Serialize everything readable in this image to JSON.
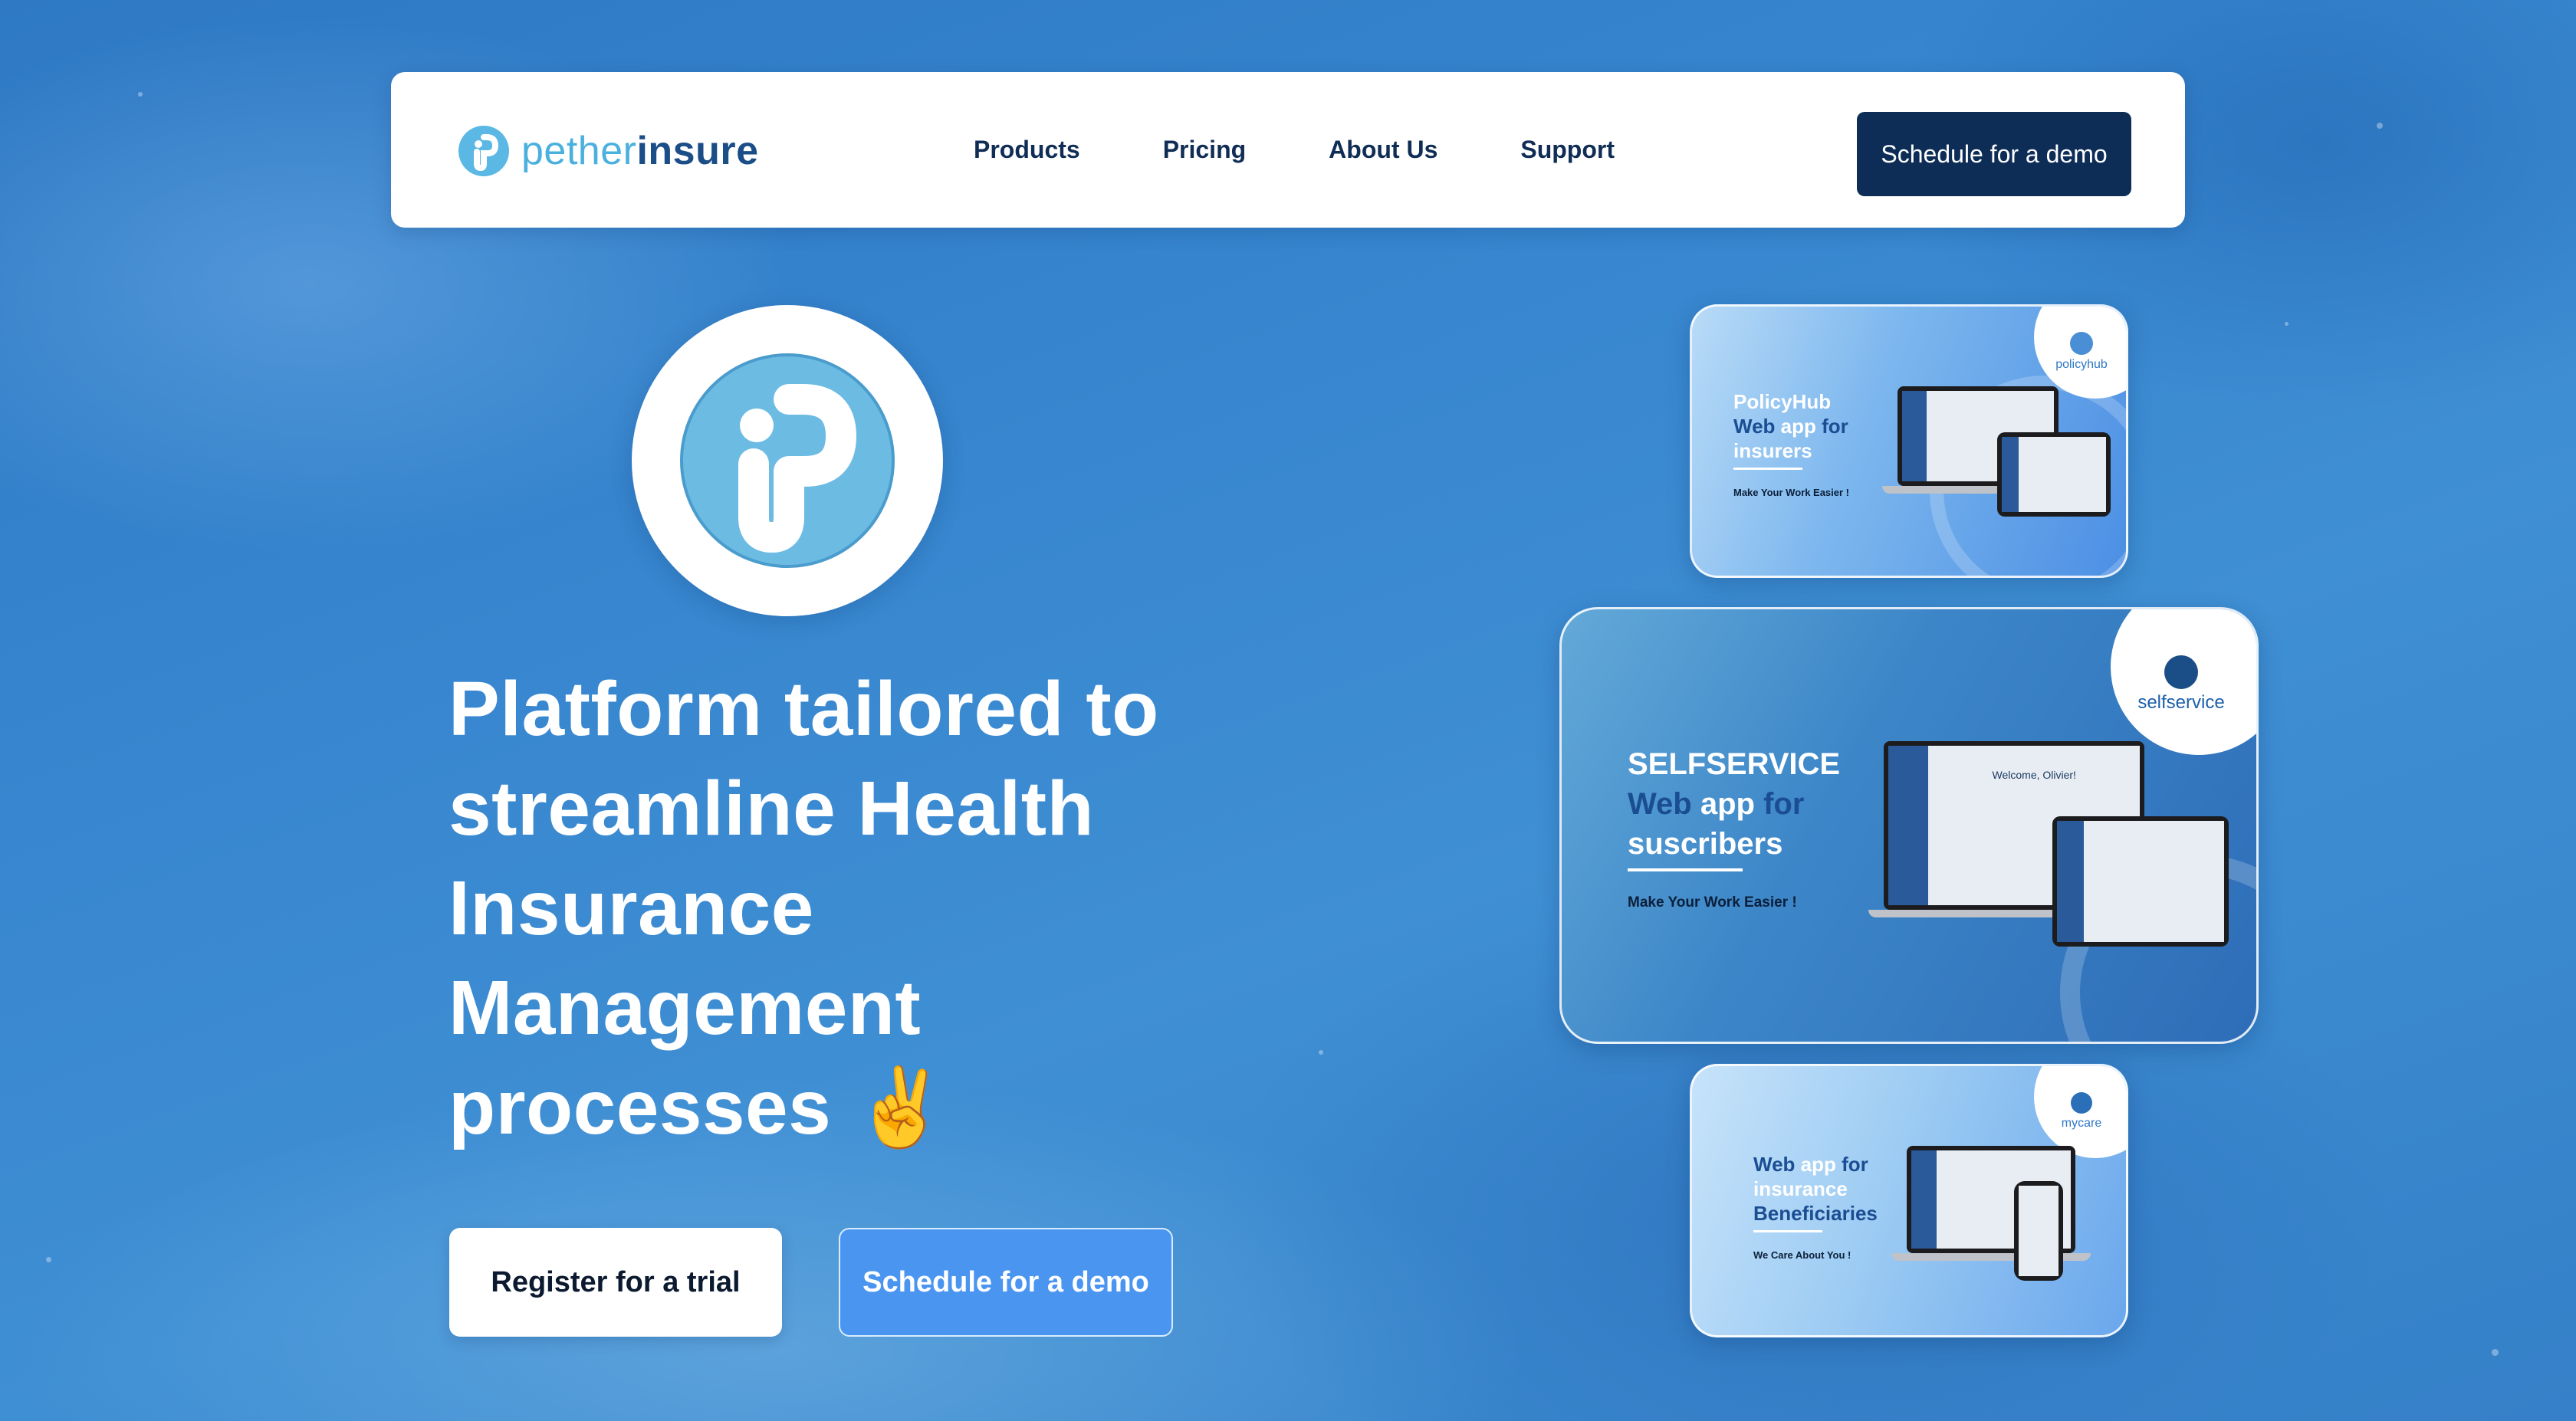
{
  "nav": {
    "logo_light": "pether",
    "logo_bold": "insure",
    "links": [
      "Products",
      "Pricing",
      "About Us",
      "Support"
    ],
    "cta": "Schedule for a demo"
  },
  "hero": {
    "headline": "Platform tailored to streamline Health Insurance Management processes ✌️",
    "trial_button": "Register for a trial",
    "demo_button": "Schedule for a demo"
  },
  "cards": [
    {
      "badge": "policyhub",
      "title_l1": "PolicyHub",
      "title_l2a": "Web",
      "title_l2b": " app ",
      "title_l2c": "for",
      "title_l3": "insurers",
      "tagline": "Make Your Work Easier !"
    },
    {
      "badge": "selfservice",
      "title_l1": "SELFSERVICE",
      "title_l2a": "Web",
      "title_l2b": " app ",
      "title_l2c": "for",
      "title_l3": "suscribers",
      "tagline": "Make Your Work Easier !",
      "screen_greeting": "Welcome, Olivier!"
    },
    {
      "badge": "mycare",
      "title_l1a": "Web",
      "title_l1b": " app ",
      "title_l1c": "for",
      "title_l2": "insurance",
      "title_l3": "Beneficiaries",
      "tagline": "We Care About You !"
    }
  ],
  "colors": {
    "navy": "#0d2d57",
    "accent_blue": "#4a95f0",
    "logo_blue": "#4ab0de"
  }
}
